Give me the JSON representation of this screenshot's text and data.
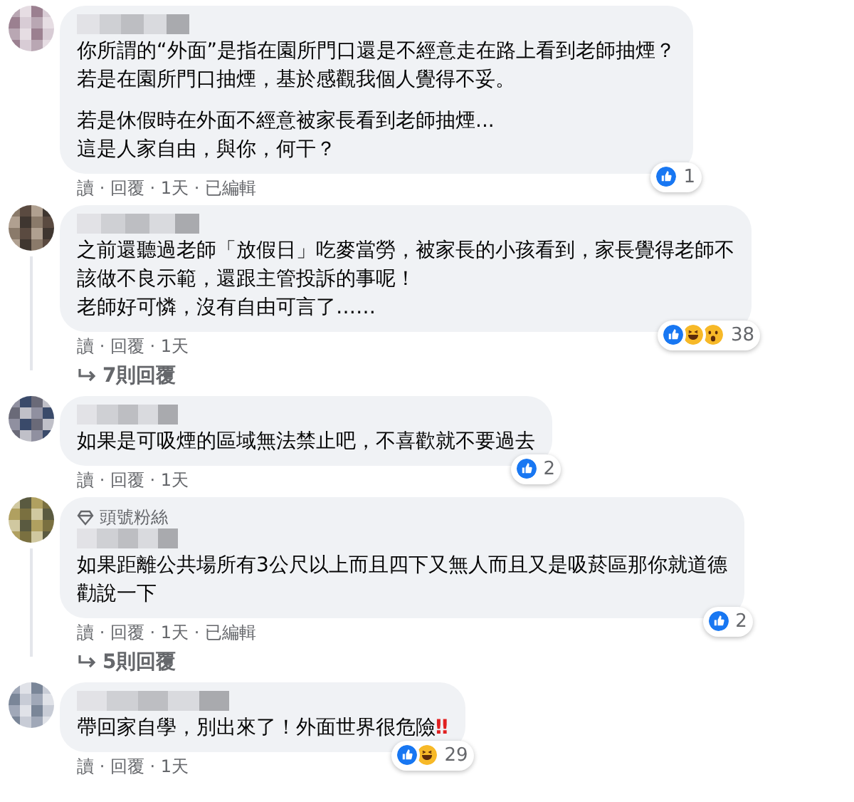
{
  "comments": [
    {
      "paragraphs": [
        [
          "你所謂的“外面”是指在園所門口還是不經意走在路上看到老師抽煙？",
          "若是在園所門口抽煙，基於感觀我個人覺得不妥。"
        ],
        [
          "若是休假時在外面不經意被家長看到老師抽煙...",
          "這是人家自由，與你，何干？"
        ]
      ],
      "reactions": [
        {
          "kind": "like"
        }
      ],
      "reaction_count": "1",
      "meta": "讀 · 回覆 · 1天 · 已編輯"
    },
    {
      "paragraphs": [
        [
          "之前還聽過老師「放假日」吃麥當勞，被家長的小孩看到，家長覺得老師不",
          "該做不良示範，還跟主管投訴的事呢！",
          "老師好可憐，沒有自由可言了……"
        ]
      ],
      "reactions": [
        {
          "kind": "like"
        },
        {
          "kind": "haha"
        },
        {
          "kind": "wow"
        }
      ],
      "reaction_count": "38",
      "meta": "讀 · 回覆 · 1天",
      "replies": "7則回覆"
    },
    {
      "paragraphs": [
        [
          "如果是可吸煙的區域無法禁止吧，不喜歡就不要過去"
        ]
      ],
      "reactions": [
        {
          "kind": "like"
        }
      ],
      "reaction_count": "2",
      "meta": "讀 · 回覆 · 1天"
    },
    {
      "badge": "頭號粉絲",
      "paragraphs": [
        [
          "如果距離公共場所有3公尺以上而且四下又無人而且又是吸菸區那你就道德",
          "勸說一下"
        ]
      ],
      "reactions": [
        {
          "kind": "like"
        }
      ],
      "reaction_count": "2",
      "meta": "讀 · 回覆 · 1天 · 已編輯",
      "replies": "5則回覆"
    },
    {
      "paragraphs": [
        [
          "帶回家自學，別出來了！外面世界很危險"
        ]
      ],
      "suffix": "‼",
      "reactions": [
        {
          "kind": "like"
        },
        {
          "kind": "haha"
        }
      ],
      "reaction_count": "29",
      "meta": "讀 · 回覆 · 1天"
    }
  ]
}
